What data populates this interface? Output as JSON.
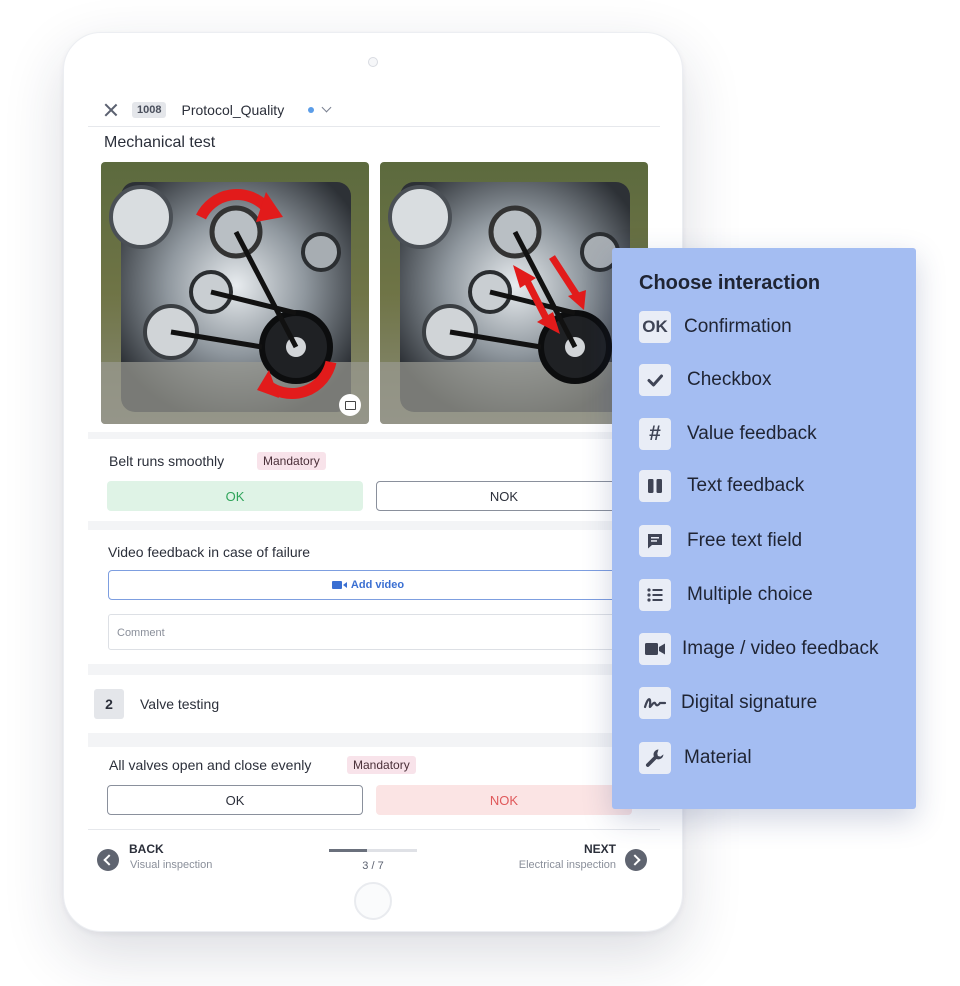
{
  "header": {
    "record_id": "1008",
    "title": "Protocol_Quality"
  },
  "section_mechanical": {
    "title": "Mechanical test"
  },
  "question_belt": {
    "label": "Belt runs smoothly",
    "badge": "Mandatory",
    "ok_label": "OK",
    "nok_label": "NOK",
    "selected": "OK"
  },
  "video_feedback": {
    "label": "Video feedback in case of failure",
    "add_video_label": "Add video",
    "comment_placeholder": "Comment"
  },
  "step_valve": {
    "number": "2",
    "title": "Valve testing"
  },
  "question_valves": {
    "label": "All valves open and close evenly",
    "badge": "Mandatory",
    "ok_label": "OK",
    "nok_label": "NOK",
    "selected": "NOK"
  },
  "footer": {
    "back_label": "BACK",
    "back_sub": "Visual inspection",
    "next_label": "NEXT",
    "next_sub": "Electrical inspection",
    "progress_text": "3 / 7",
    "progress_fraction": 0.43
  },
  "panel": {
    "title": "Choose interaction",
    "items": [
      {
        "label": "Confirmation",
        "icon": "ok-icon",
        "glyph": "OK"
      },
      {
        "label": "Checkbox",
        "icon": "check-icon",
        "glyph": ""
      },
      {
        "label": "Value feedback",
        "icon": "hash-icon",
        "glyph": "#"
      },
      {
        "label": "Text feedback",
        "icon": "text-feedback-icon",
        "glyph": ""
      },
      {
        "label": "Free text field",
        "icon": "chat-icon",
        "glyph": ""
      },
      {
        "label": "Multiple choice",
        "icon": "list-icon",
        "glyph": ""
      },
      {
        "label": "Image / video feedback",
        "icon": "video-icon",
        "glyph": ""
      },
      {
        "label": "Digital signature",
        "icon": "signature-icon",
        "glyph": ""
      },
      {
        "label": "Material",
        "icon": "wrench-icon",
        "glyph": ""
      }
    ]
  },
  "colors": {
    "panel_bg": "#a4bdf2",
    "ok_active_bg": "#dff3e6",
    "ok_active_text": "#2fa45a",
    "nok_active_bg": "#fbe4e4",
    "nok_active_text": "#e0585a",
    "badge_bg": "#f8e3ea",
    "video_button": "#3a6fd2",
    "status_dot": "#5b9de8",
    "arrow_red": "#e21b1b"
  }
}
